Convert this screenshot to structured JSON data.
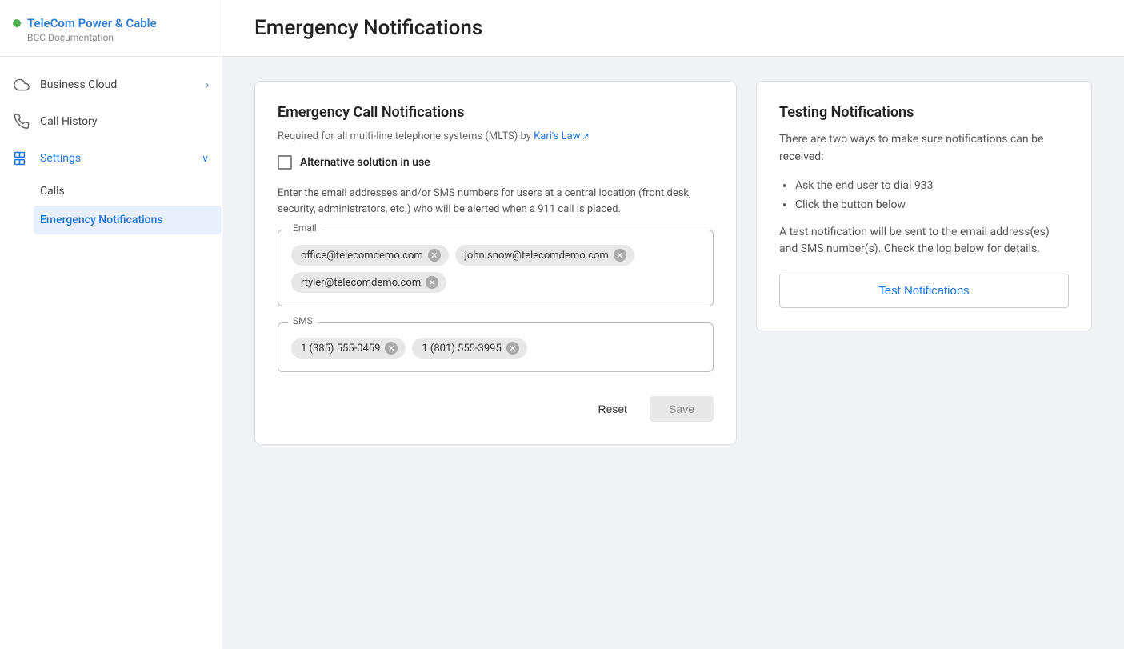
{
  "brand": {
    "name": "TeleCom Power & Cable",
    "subtitle": "BCC Documentation",
    "dot_color": "#4caf50"
  },
  "sidebar": {
    "nav": [
      {
        "id": "business-cloud",
        "label": "Business Cloud",
        "icon": "cloud",
        "has_chevron": true,
        "active": false
      },
      {
        "id": "call-history",
        "label": "Call History",
        "icon": "phone",
        "has_chevron": false,
        "active": false
      }
    ],
    "settings": {
      "label": "Settings",
      "icon": "settings",
      "active": true,
      "children": [
        {
          "id": "calls",
          "label": "Calls",
          "active": false
        },
        {
          "id": "emergency-notifications",
          "label": "Emergency Notifications",
          "active": true
        }
      ]
    }
  },
  "page": {
    "title": "Emergency Notifications"
  },
  "left_card": {
    "title": "Emergency Call Notifications",
    "subtitle_text": "Required for all multi-line telephone systems (MLTS) by ",
    "karis_link_text": "Kari's Law",
    "checkbox_label": "Alternative solution in use",
    "field_description": "Enter the email addresses and/or SMS numbers for users at a central location (front desk, security, administrators, etc.) who will be alerted when a 911 call is placed.",
    "email_legend": "Email",
    "email_tags": [
      "office@telecomdemo.com",
      "john.snow@telecomdemo.com",
      "rtyler@telecomdemo.com"
    ],
    "sms_legend": "SMS",
    "sms_tags": [
      "1 (385) 555-0459",
      "1 (801) 555-3995"
    ],
    "btn_reset": "Reset",
    "btn_save": "Save"
  },
  "right_card": {
    "title": "Testing Notifications",
    "description": "There are two ways to make sure notifications can be received:",
    "list_items": [
      "Ask the end user to dial 933",
      "Click the button below"
    ],
    "note": "A test notification will be sent to the email address(es) and SMS number(s). Check the log below for details.",
    "btn_test_label": "Test Notifications"
  }
}
